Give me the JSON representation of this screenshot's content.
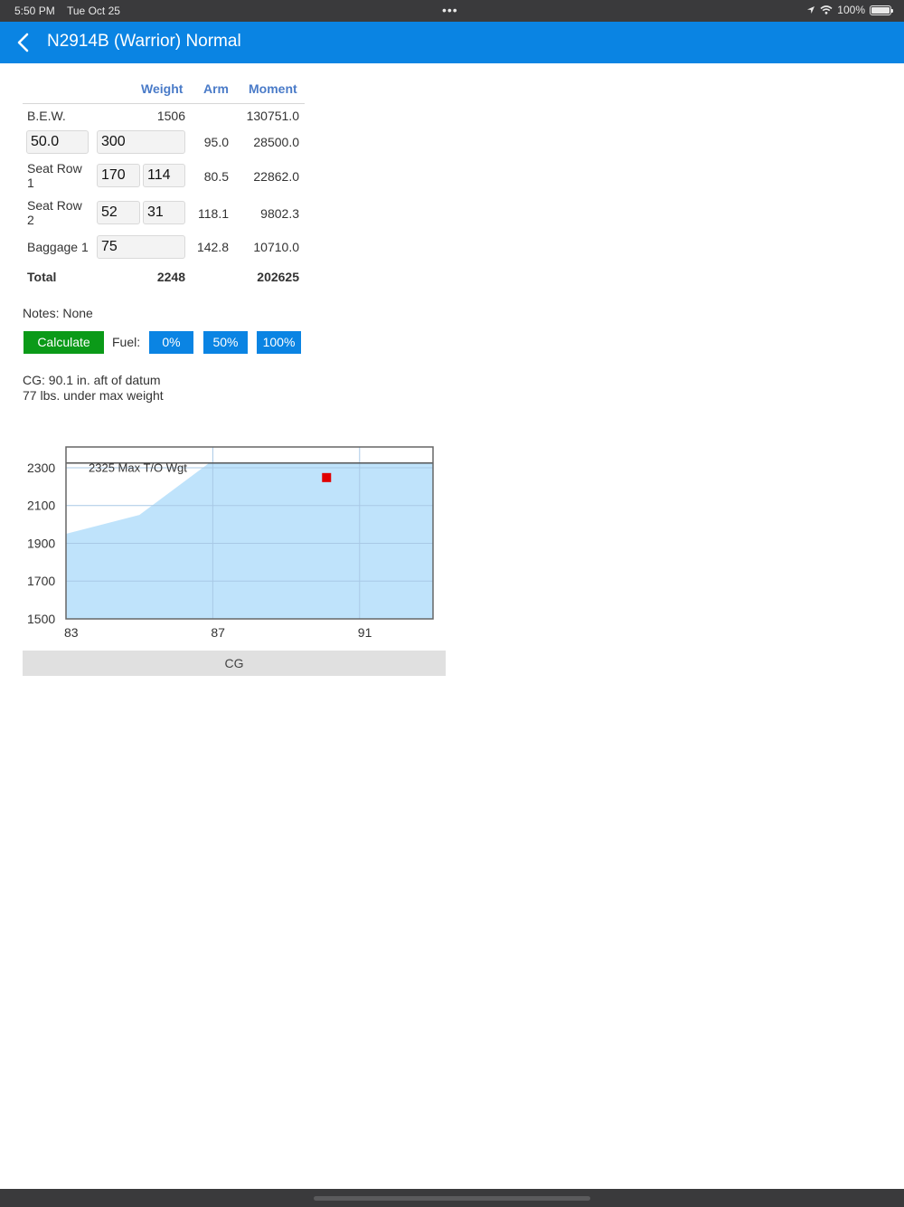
{
  "status": {
    "time": "5:50 PM",
    "date": "Tue Oct 25",
    "dots": "•••",
    "battery": "100%"
  },
  "nav": {
    "title": "N2914B (Warrior) Normal"
  },
  "table": {
    "headers": {
      "weight": "Weight",
      "arm": "Arm",
      "moment": "Moment"
    },
    "bew": {
      "label": "B.E.W.",
      "weight": "1506",
      "moment": "130751.0"
    },
    "fuel_row": {
      "gallons": "50.0",
      "weight": "300",
      "arm": "95.0",
      "moment": "28500.0"
    },
    "seat1": {
      "label": "Seat Row 1",
      "left": "170",
      "right": "114",
      "arm": "80.5",
      "moment": "22862.0"
    },
    "seat2": {
      "label": "Seat Row 2",
      "left": "52",
      "right": "31",
      "arm": "118.1",
      "moment": "9802.3"
    },
    "baggage": {
      "label": "Baggage 1",
      "weight": "75",
      "arm": "142.8",
      "moment": "10710.0"
    },
    "total": {
      "label": "Total",
      "weight": "2248",
      "moment": "202625"
    }
  },
  "notes": "Notes: None",
  "buttons": {
    "calculate": "Calculate",
    "fuel_label": "Fuel:",
    "fuel_0": "0%",
    "fuel_50": "50%",
    "fuel_100": "100%"
  },
  "results": {
    "cg": "CG: 90.1 in. aft of datum",
    "weight": "77 lbs. under max weight"
  },
  "chart_data": {
    "type": "scatter",
    "xlabel": "CG",
    "x_ticks": [
      "83",
      "87",
      "91"
    ],
    "y_ticks": [
      "2300",
      "2100",
      "1900",
      "1700",
      "1500"
    ],
    "xlim": [
      83,
      93
    ],
    "ylim": [
      1500,
      2410
    ],
    "annotation": "2325 Max T/O Wgt",
    "max_weight": 2325,
    "envelope": [
      [
        83,
        1500
      ],
      [
        83,
        1950
      ],
      [
        85,
        2050
      ],
      [
        86.9,
        2325
      ],
      [
        93,
        2325
      ],
      [
        93,
        1500
      ]
    ],
    "point": {
      "x": 90.1,
      "y": 2248
    },
    "colors": {
      "envelope": "#bfe3fb",
      "point": "#e00000",
      "grid": "#a9c9e6"
    }
  }
}
